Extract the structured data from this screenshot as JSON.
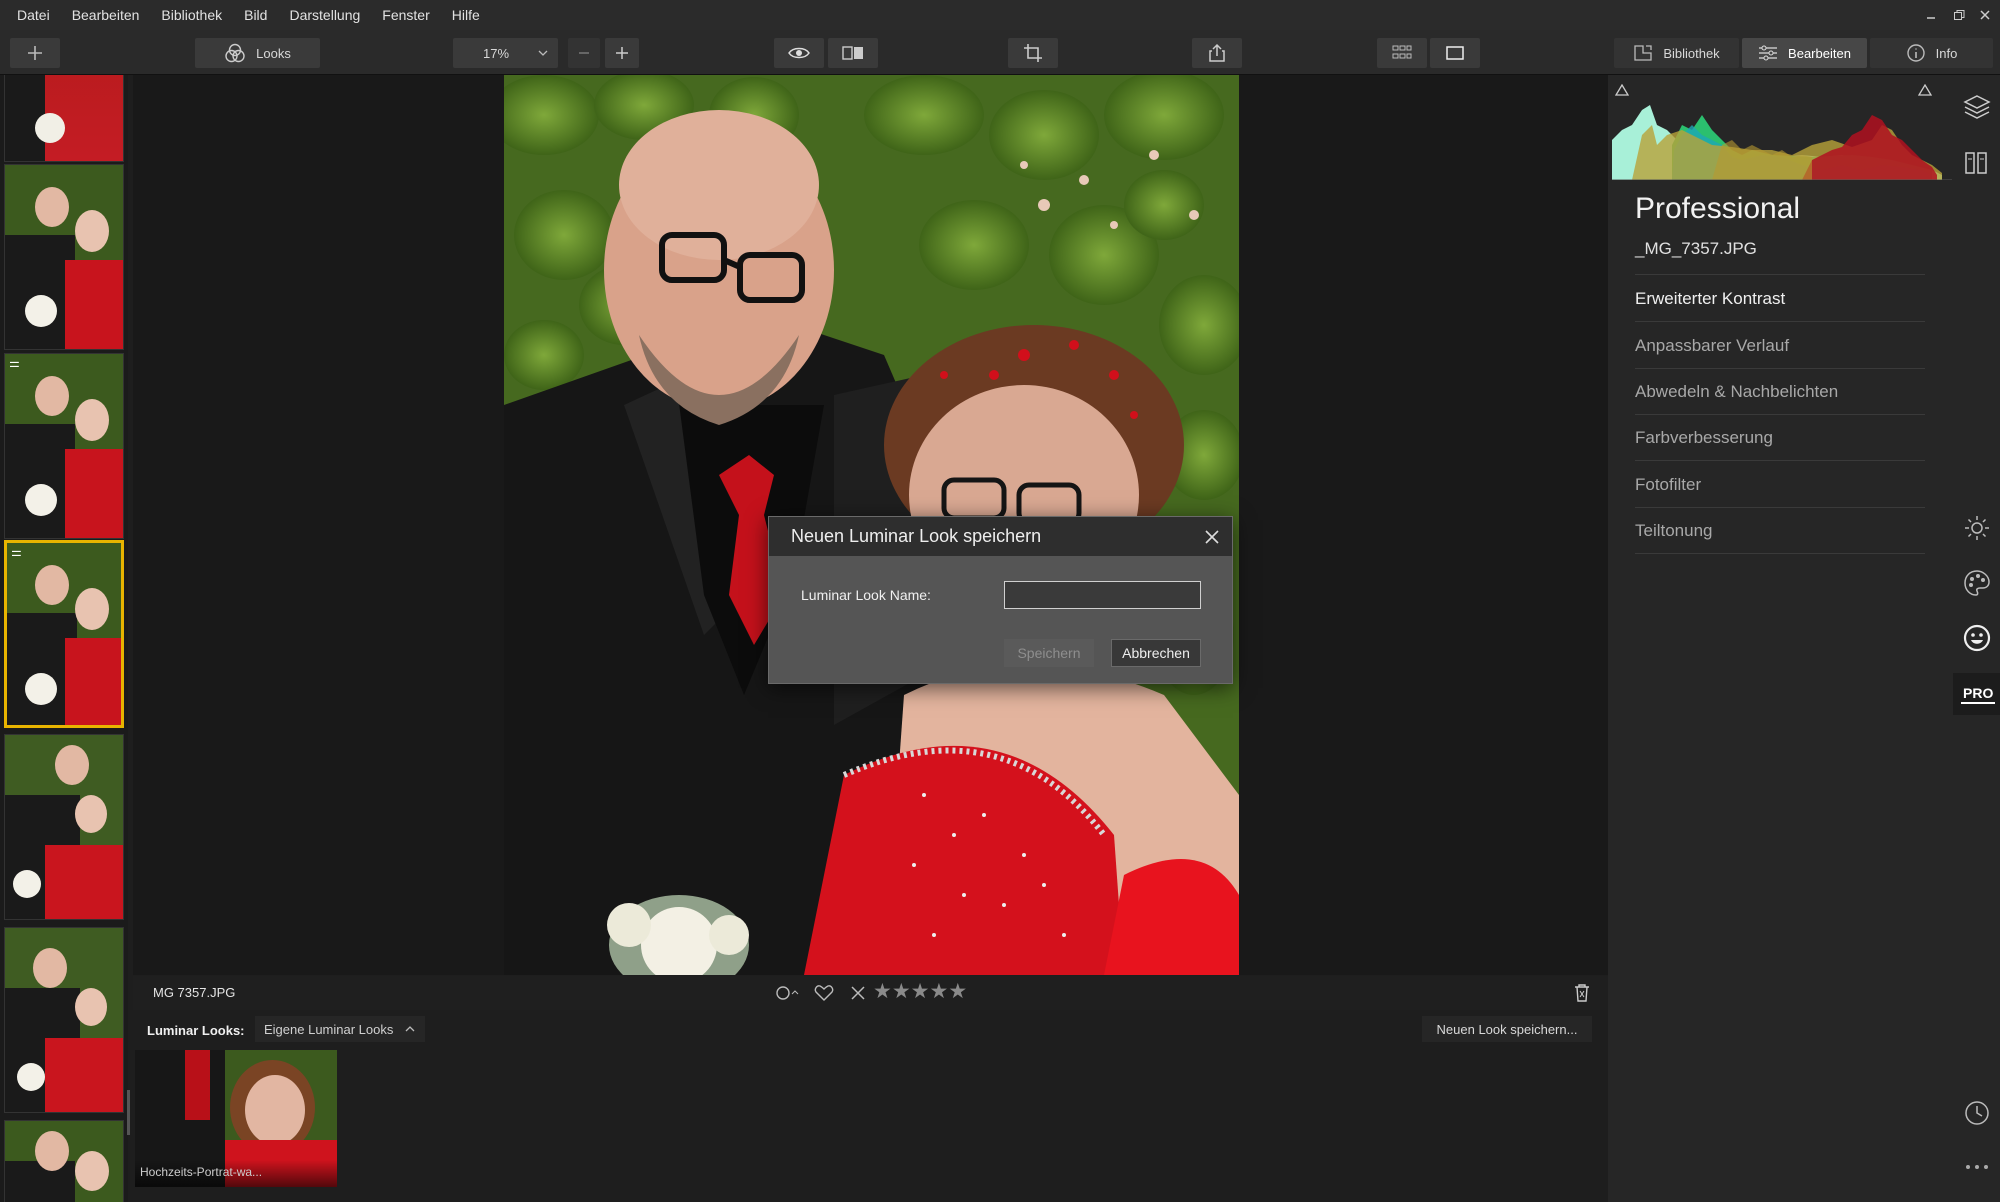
{
  "menu": [
    "Datei",
    "Bearbeiten",
    "Bibliothek",
    "Bild",
    "Darstellung",
    "Fenster",
    "Hilfe"
  ],
  "toolbar": {
    "looks_label": "Looks",
    "zoom_value": "17%",
    "library_label": "Bibliothek",
    "edit_label": "Bearbeiten",
    "info_label": "Info"
  },
  "viewer": {
    "filename": "MG 7357.JPG"
  },
  "looks": {
    "label": "Luminar Looks:",
    "dropdown": "Eigene Luminar Looks",
    "save_new": "Neuen Look speichern...",
    "items": [
      {
        "name": "Hochzeits-Portrat-wa..."
      }
    ]
  },
  "panel": {
    "workspace": "Professional",
    "filename": "_MG_7357.JPG",
    "tools": [
      "Erweiterter Kontrast",
      "Anpassbarer Verlauf",
      "Abwedeln & Nachbelichten",
      "Farbverbesserung",
      "Fotofilter",
      "Teiltonung"
    ]
  },
  "dialog": {
    "title": "Neuen Luminar Look speichern",
    "field_label": "Luminar Look Name:",
    "field_value": "",
    "save_button": "Speichern",
    "cancel_button": "Abbrechen"
  },
  "colors": {
    "accent_selection": "#e8b400",
    "app_bg": "#1e1e1e",
    "dress_red": "#d4111c"
  }
}
